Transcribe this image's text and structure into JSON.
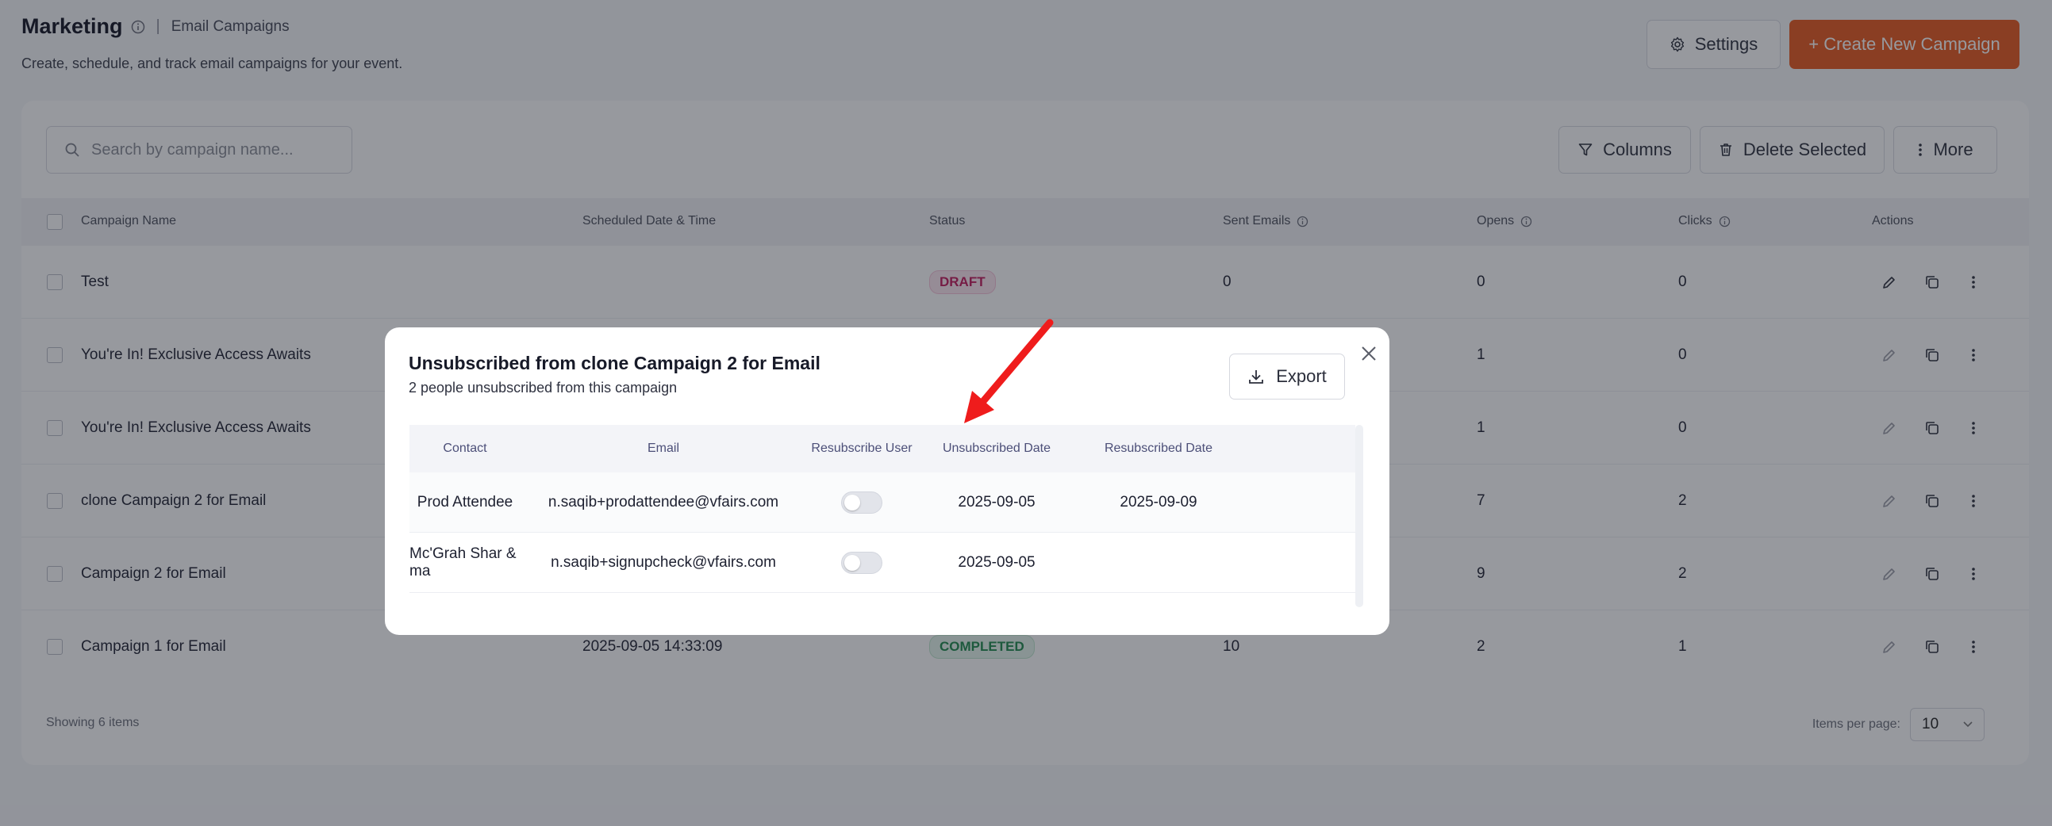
{
  "header": {
    "title": "Marketing",
    "breadcrumb": "Email Campaigns",
    "subtitle": "Create, schedule, and track email campaigns for your event.",
    "settings_label": "Settings",
    "create_label": "+ Create New Campaign"
  },
  "toolbar": {
    "search_placeholder": "Search by campaign name...",
    "columns_label": "Columns",
    "delete_label": "Delete Selected",
    "more_label": "More"
  },
  "table": {
    "headers": {
      "name": "Campaign Name",
      "scheduled": "Scheduled Date & Time",
      "status": "Status",
      "sent": "Sent Emails",
      "opens": "Opens",
      "clicks": "Clicks",
      "actions": "Actions"
    },
    "rows": [
      {
        "name": "Test",
        "scheduled": "",
        "status": "DRAFT",
        "sent": "0",
        "opens": "0",
        "clicks": "0"
      },
      {
        "name": "You're In! Exclusive Access Awaits",
        "scheduled": "",
        "status": "",
        "sent": "",
        "opens": "1",
        "clicks": "0"
      },
      {
        "name": "You're In! Exclusive Access Awaits",
        "scheduled": "",
        "status": "",
        "sent": "",
        "opens": "1",
        "clicks": "0"
      },
      {
        "name": "clone Campaign 2 for Email",
        "scheduled": "",
        "status": "",
        "sent": "",
        "opens": "7",
        "clicks": "2"
      },
      {
        "name": "Campaign 2 for Email",
        "scheduled": "",
        "status": "",
        "sent": "",
        "opens": "9",
        "clicks": "2"
      },
      {
        "name": "Campaign 1 for Email",
        "scheduled": "2025-09-05 14:33:09",
        "status": "COMPLETED",
        "sent": "10",
        "opens": "2",
        "clicks": "1"
      }
    ]
  },
  "footer": {
    "showing": "Showing 6 items",
    "items_per_page_label": "Items per page:",
    "items_per_page": "10"
  },
  "modal": {
    "title": "Unsubscribed from clone Campaign 2 for Email",
    "subtitle": "2 people unsubscribed from this campaign",
    "export_label": "Export",
    "headers": {
      "contact": "Contact",
      "email": "Email",
      "resubscribe": "Resubscribe User",
      "unsubscribed": "Unsubscribed Date",
      "resubscribed": "Resubscribed Date"
    },
    "rows": [
      {
        "contact": "Prod Attendee",
        "email": "n.saqib+prodattendee@vfairs.com",
        "resubscribe": false,
        "unsubscribed": "2025-09-05",
        "resubscribed": "2025-09-09"
      },
      {
        "contact": "Mc'Grah Shar & ma",
        "email": "n.saqib+signupcheck@vfairs.com",
        "resubscribe": false,
        "unsubscribed": "2025-09-05",
        "resubscribed": ""
      }
    ]
  },
  "colors": {
    "primary": "#e8581c",
    "draft": "#c2185b",
    "completed": "#1f8a4c",
    "annotation_arrow": "#ef1c1c"
  }
}
